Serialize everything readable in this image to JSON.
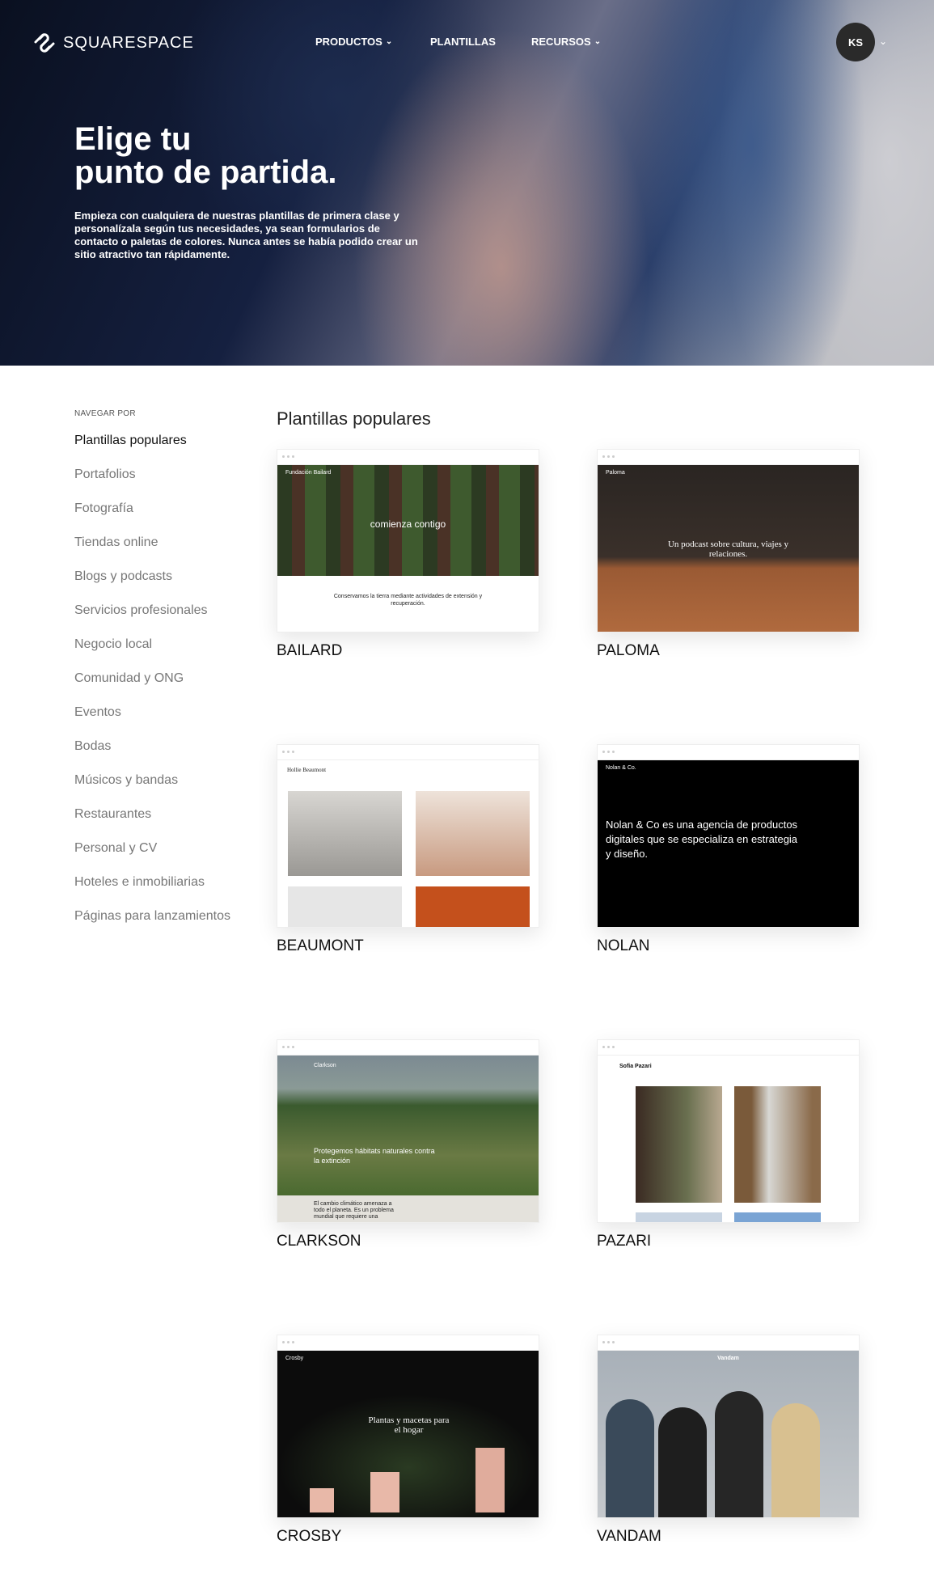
{
  "header": {
    "brand": "SQUARESPACE",
    "nav": [
      {
        "label": "PRODUCTOS",
        "dropdown": true
      },
      {
        "label": "PLANTILLAS",
        "dropdown": false
      },
      {
        "label": "RECURSOS",
        "dropdown": true
      }
    ],
    "avatar_initials": "KS"
  },
  "hero": {
    "title_line1": "Elige tu",
    "title_line2": "punto de partida.",
    "description": "Empieza con cualquiera de nuestras plantillas de primera clase y personalízala según tus necesidades, ya sean formularios de contacto o paletas de colores. Nunca antes se había podido crear un sitio atractivo tan rápidamente."
  },
  "sidebar": {
    "heading": "NAVEGAR POR",
    "items": [
      "Plantillas populares",
      "Portafolios",
      "Fotografía",
      "Tiendas online",
      "Blogs y podcasts",
      "Servicios profesionales",
      "Negocio local",
      "Comunidad y ONG",
      "Eventos",
      "Bodas",
      "Músicos y bandas",
      "Restaurantes",
      "Personal y CV",
      "Hoteles e inmobiliarias",
      "Páginas para lanzamientos"
    ],
    "active_index": 0
  },
  "main": {
    "title": "Plantillas populares",
    "templates": [
      {
        "name": "BAILARD",
        "preview": {
          "brand": "Fundación Bailard",
          "headline": "comienza contigo",
          "body": "Conservamos la tierra mediante actividades de extensión y recuperación."
        }
      },
      {
        "name": "PALOMA",
        "preview": {
          "brand": "Paloma",
          "headline": "Un podcast sobre cultura, viajes y relaciones."
        }
      },
      {
        "name": "BEAUMONT",
        "preview": {
          "brand": "Hollie Beaumont"
        }
      },
      {
        "name": "NOLAN",
        "preview": {
          "brand": "Nolan & Co.",
          "headline": "Nolan & Co es una agencia de productos digitales que se especializa en estrategia y diseño."
        }
      },
      {
        "name": "CLARKSON",
        "preview": {
          "brand": "Clarkson",
          "headline": "Protegemos hábitats naturales contra la extinción",
          "body": "El cambio climático amenaza a todo el planeta. Es un problema mundial que requiere una"
        }
      },
      {
        "name": "PAZARI",
        "preview": {
          "brand": "Sofia Pazari"
        }
      },
      {
        "name": "CROSBY",
        "preview": {
          "brand": "Crosby",
          "headline": "Plantas y macetas para el hogar"
        }
      },
      {
        "name": "VANDAM",
        "preview": {
          "brand": "Vandam"
        }
      }
    ]
  }
}
